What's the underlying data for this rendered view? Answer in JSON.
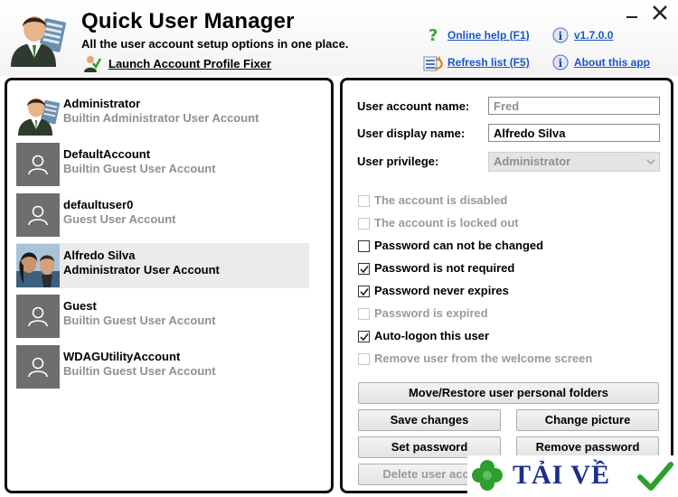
{
  "header": {
    "title": "Quick User Manager",
    "subtitle": "All the user account setup options in one place.",
    "fixer_link": "Launch Account Profile Fixer",
    "help_link": "Online help (F1)",
    "version_link": "v1.7.0.0",
    "refresh_link": "Refresh list (F5)",
    "about_link": "About this app"
  },
  "users": [
    {
      "name": "Administrator",
      "desc": "Builtin Administrator User Account",
      "avatar": "admin-manager-icon"
    },
    {
      "name": "DefaultAccount",
      "desc": "Builtin Guest User Account",
      "avatar": "generic-user-icon"
    },
    {
      "name": "defaultuser0",
      "desc": "Guest User Account",
      "avatar": "generic-user-icon"
    },
    {
      "name": "Alfredo Silva",
      "desc": "Administrator User Account",
      "avatar": "photo-avatar"
    },
    {
      "name": "Guest",
      "desc": "Builtin Guest User Account",
      "avatar": "generic-user-icon"
    },
    {
      "name": "WDAGUtilityAccount",
      "desc": "Builtin Guest User Account",
      "avatar": "generic-user-icon"
    }
  ],
  "form": {
    "account_name_label": "User account name:",
    "account_name_value": "Fred",
    "display_name_label": "User display name:",
    "display_name_value": "Alfredo Silva",
    "privilege_label": "User privilege:",
    "privilege_value": "Administrator"
  },
  "options": [
    {
      "label": "The account is disabled",
      "checked": false,
      "disabled": true
    },
    {
      "label": "The account is locked out",
      "checked": false,
      "disabled": true
    },
    {
      "label": "Password can not be changed",
      "checked": false,
      "disabled": false
    },
    {
      "label": "Password is not required",
      "checked": true,
      "disabled": false
    },
    {
      "label": "Password never expires",
      "checked": true,
      "disabled": false
    },
    {
      "label": "Password is expired",
      "checked": false,
      "disabled": true
    },
    {
      "label": "Auto-logon this user",
      "checked": true,
      "disabled": false
    },
    {
      "label": "Remove user from the welcome screen",
      "checked": false,
      "disabled": true
    }
  ],
  "buttons": {
    "move_restore": "Move/Restore user personal folders",
    "save": "Save changes",
    "change_picture": "Change picture",
    "set_password": "Set password",
    "remove_password": "Remove password",
    "delete_user": "Delete user acco"
  },
  "watermark": {
    "text": "TẢI VỀ"
  },
  "colors": {
    "link": "#1a55c9",
    "check_green": "#2e9e2e",
    "watermark_blue": "#1c2f8c"
  }
}
